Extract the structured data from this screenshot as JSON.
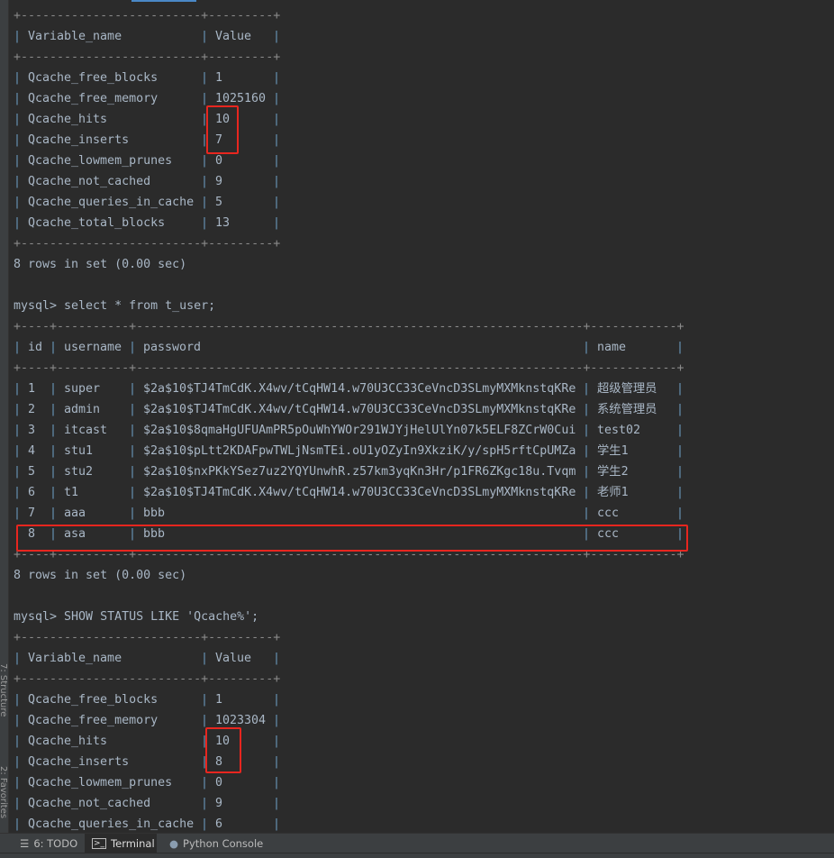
{
  "side_tabs": {
    "structure": "7: Structure",
    "favorites": "2: Favorites"
  },
  "terminal": {
    "blocks": [
      {
        "type": "table",
        "id": "status1",
        "columns": [
          "Variable_name",
          "Value"
        ],
        "widths": [
          25,
          9
        ],
        "rows": [
          [
            "Qcache_free_blocks",
            "1"
          ],
          [
            "Qcache_free_memory",
            "1025160"
          ],
          [
            "Qcache_hits",
            "10"
          ],
          [
            "Qcache_inserts",
            "7"
          ],
          [
            "Qcache_lowmem_prunes",
            "0"
          ],
          [
            "Qcache_not_cached",
            "9"
          ],
          [
            "Qcache_queries_in_cache",
            "5"
          ],
          [
            "Qcache_total_blocks",
            "13"
          ]
        ]
      },
      {
        "type": "text",
        "text": "8 rows in set (0.00 sec)"
      },
      {
        "type": "blank"
      },
      {
        "type": "text",
        "text": "mysql> select * from t_user;"
      },
      {
        "type": "table",
        "id": "t_user",
        "columns": [
          "id",
          "username",
          "password",
          "name"
        ],
        "widths": [
          4,
          10,
          62,
          12
        ],
        "rows": [
          [
            "1",
            "super",
            "$2a$10$TJ4TmCdK.X4wv/tCqHW14.w70U3CC33CeVncD3SLmyMXMknstqKRe",
            "超级管理员"
          ],
          [
            "2",
            "admin",
            "$2a$10$TJ4TmCdK.X4wv/tCqHW14.w70U3CC33CeVncD3SLmyMXMknstqKRe",
            "系统管理员"
          ],
          [
            "3",
            "itcast",
            "$2a$10$8qmaHgUFUAmPR5pOuWhYWOr291WJYjHelUlYn07k5ELF8ZCrW0Cui",
            "test02"
          ],
          [
            "4",
            "stu1",
            "$2a$10$pLtt2KDAFpwTWLjNsmTEi.oU1yOZyIn9XkziK/y/spH5rftCpUMZa",
            "学生1"
          ],
          [
            "5",
            "stu2",
            "$2a$10$nxPKkYSez7uz2YQYUnwhR.z57km3yqKn3Hr/p1FR6ZKgc18u.Tvqm",
            "学生2"
          ],
          [
            "6",
            "t1",
            "$2a$10$TJ4TmCdK.X4wv/tCqHW14.w70U3CC33CeVncD3SLmyMXMknstqKRe",
            "老师1"
          ],
          [
            "7",
            "aaa",
            "bbb",
            "ccc"
          ],
          [
            "8",
            "asa",
            "bbb",
            "ccc"
          ]
        ]
      },
      {
        "type": "text",
        "text": "8 rows in set (0.00 sec)"
      },
      {
        "type": "blank"
      },
      {
        "type": "text",
        "text": "mysql> SHOW STATUS LIKE 'Qcache%';"
      },
      {
        "type": "table",
        "id": "status2",
        "columns": [
          "Variable_name",
          "Value"
        ],
        "widths": [
          25,
          9
        ],
        "rows": [
          [
            "Qcache_free_blocks",
            "1"
          ],
          [
            "Qcache_free_memory",
            "1023304"
          ],
          [
            "Qcache_hits",
            "10"
          ],
          [
            "Qcache_inserts",
            "8"
          ],
          [
            "Qcache_lowmem_prunes",
            "0"
          ],
          [
            "Qcache_not_cached",
            "9"
          ],
          [
            "Qcache_queries_in_cache",
            "6"
          ]
        ]
      }
    ],
    "highlight_color": "#e8261f"
  },
  "bottom_tabs": [
    {
      "label": "6: TODO",
      "icon": "list-icon"
    },
    {
      "label": "Terminal",
      "icon": "terminal-icon",
      "active": true
    },
    {
      "label": "Python Console",
      "icon": "python-icon"
    }
  ]
}
